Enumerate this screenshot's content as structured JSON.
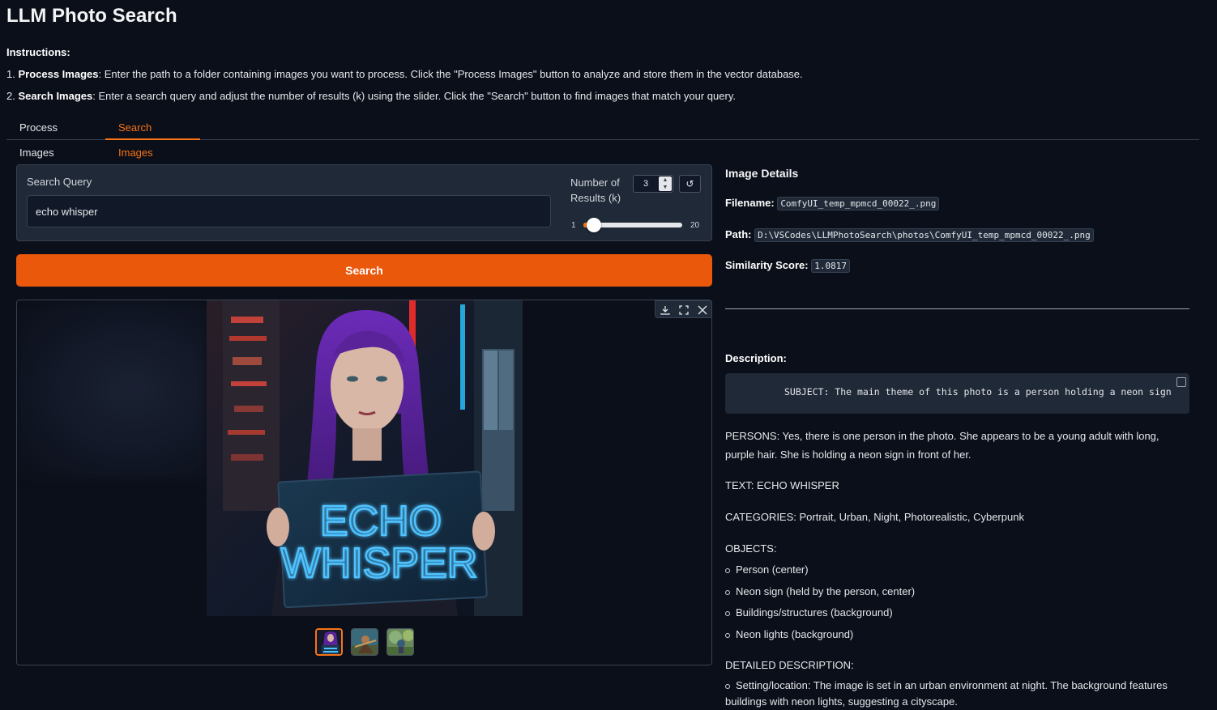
{
  "app": {
    "title": "LLM Photo Search"
  },
  "instructions": {
    "heading": "Instructions:",
    "step1_num": "1.",
    "step1_bold": "Process Images",
    "step1_text": ": Enter the path to a folder containing images you want to process. Click the \"Process Images\" button to analyze and store them in the vector database.",
    "step2_num": "2.",
    "step2_bold": "Search Images",
    "step2_text": ": Enter a search query and adjust the number of results (k) using the slider. Click the \"Search\" button to find images that match your query."
  },
  "tabs": [
    {
      "label": "Process Images",
      "active": false
    },
    {
      "label": "Search Images",
      "active": true
    }
  ],
  "search": {
    "query_label": "Search Query",
    "query_value": "echo whisper",
    "k_label": "Number of Results (k)",
    "k_value": "3",
    "k_min": "1",
    "k_max": "20",
    "k_fraction": 0.105,
    "reset_icon": "↺",
    "button_label": "Search"
  },
  "gallery": {
    "sign_line1": "ECHO",
    "sign_line2": "WHISPER",
    "tools": [
      "download-icon",
      "fullscreen-icon",
      "close-icon"
    ],
    "thumbnails": 3,
    "selected_index": 0
  },
  "details": {
    "heading": "Image Details",
    "filename_label": "Filename:",
    "filename": "ComfyUI_temp_mpmcd_00022_.png",
    "path_label": "Path:",
    "path": "D:\\VSCodes\\LLMPhotoSearch\\photos\\ComfyUI_temp_mpmcd_00022_.png",
    "score_label": "Similarity Score:",
    "score": "1.0817",
    "description_label": "Description:",
    "subject_code": "SUBJECT: The main theme of this photo is a person holding a neon sign",
    "persons": "PERSONS: Yes, there is one person in the photo. She appears to be a young adult with long, purple hair. She is holding a neon sign in front of her.",
    "text": "TEXT: ECHO WHISPER",
    "categories": "CATEGORIES: Portrait, Urban, Night, Photorealistic, Cyberpunk",
    "objects_label": "OBJECTS:",
    "objects": [
      "Person (center)",
      "Neon sign (held by the person, center)",
      "Buildings/structures (background)",
      "Neon lights (background)"
    ],
    "detailed_label": "DETAILED DESCRIPTION:",
    "detailed_setting": "Setting/location: The image is set in an urban environment at night. The background features buildings with neon lights, suggesting a cityscape."
  },
  "colors": {
    "accent": "#f97316",
    "button": "#ea580c",
    "background": "#0b0f19",
    "panel": "#1f2937"
  }
}
